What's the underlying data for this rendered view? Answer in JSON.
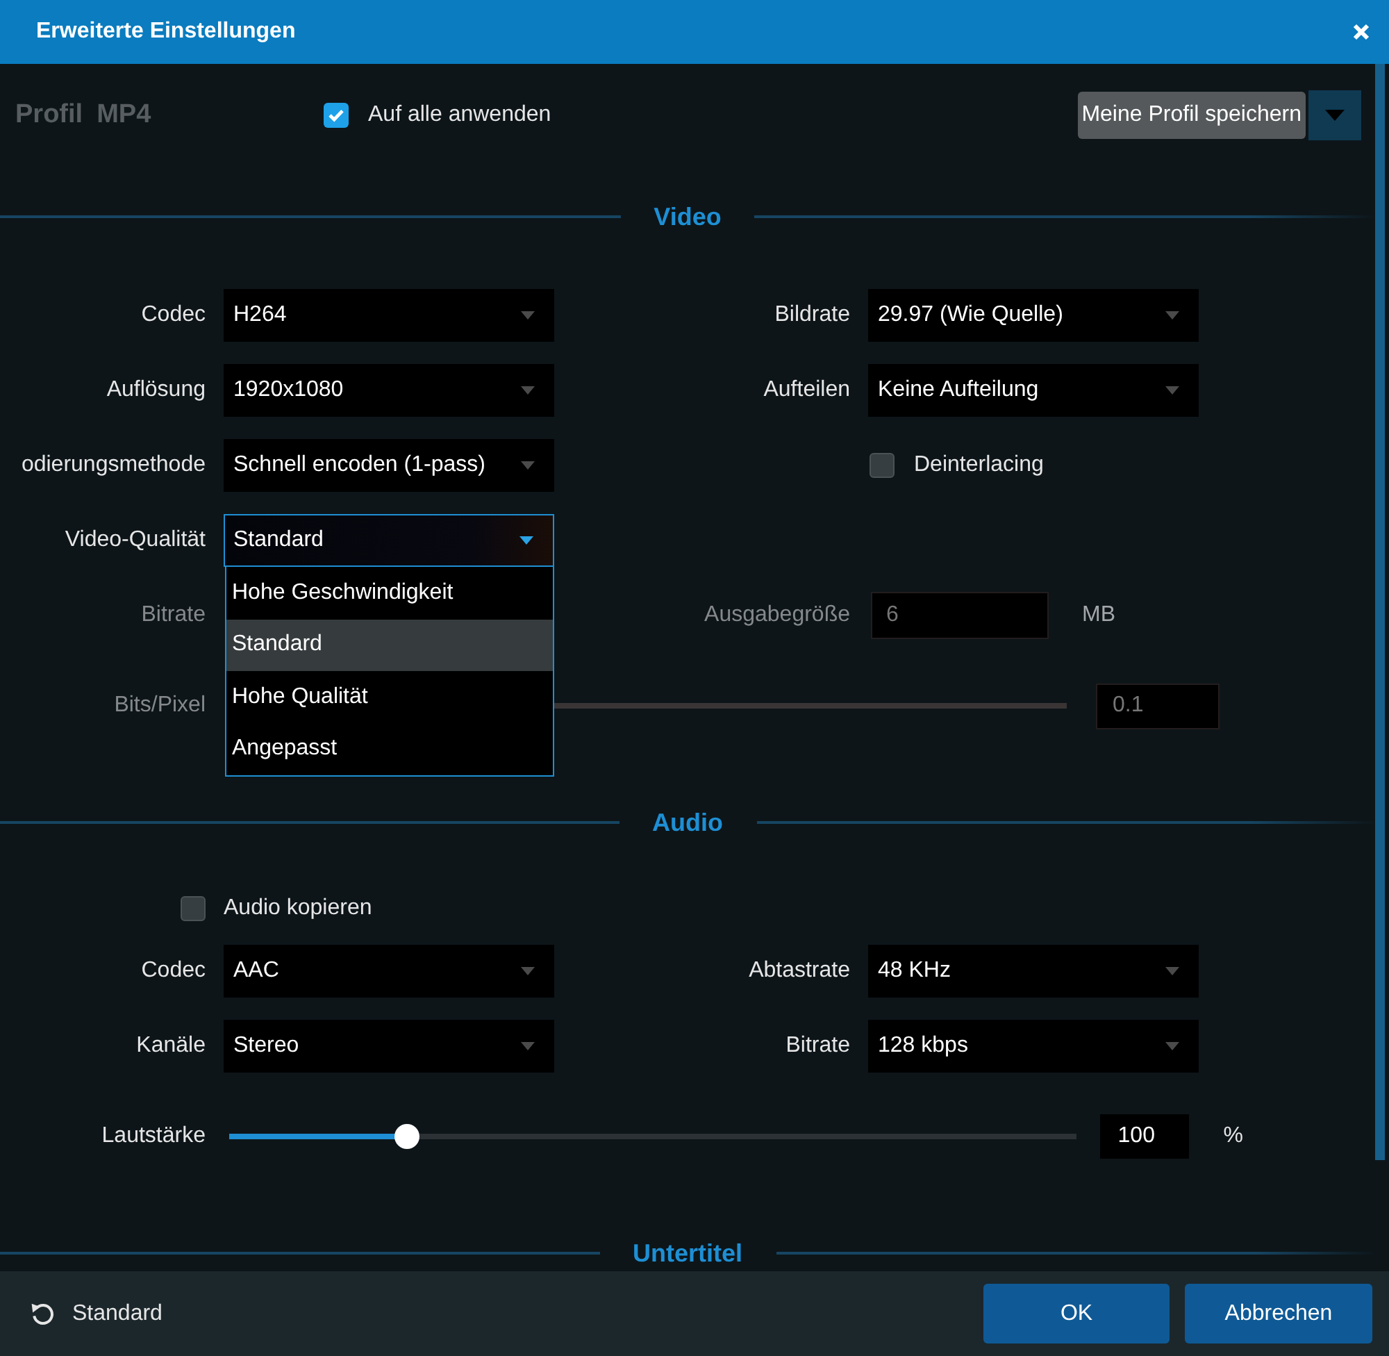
{
  "window": {
    "title": "Erweiterte Einstellungen"
  },
  "profile": {
    "label": "Profil",
    "name": "MP4",
    "apply_all": {
      "label": "Auf alle anwenden",
      "checked": true
    },
    "save_button": "Meine Profil speichern"
  },
  "sections": [
    {
      "title": "Video",
      "rows": [
        {
          "left": {
            "kind": "select",
            "label": "Codec",
            "value": "H264",
            "expanded": false,
            "disabled": false
          },
          "right": {
            "kind": "select",
            "label": "Bildrate",
            "value": "29.97 (Wie Quelle)",
            "expanded": false,
            "disabled": false
          }
        },
        {
          "left": {
            "kind": "select",
            "label": "Auflösung",
            "value": "1920x1080",
            "expanded": false,
            "disabled": false
          },
          "right": {
            "kind": "select",
            "label": "Aufteilen",
            "value": "Keine Aufteilung",
            "expanded": false,
            "disabled": false
          }
        },
        {
          "left": {
            "kind": "select",
            "label": "odierungsmethode",
            "value": "Schnell encoden (1-pass)",
            "expanded": false,
            "disabled": false
          },
          "right": {
            "kind": "checkbox",
            "label": "Deinterlacing",
            "checked": false,
            "disabled": false
          }
        },
        {
          "left": {
            "kind": "select",
            "label": "Video-Qualität",
            "value": "Standard",
            "expanded": true,
            "disabled": false,
            "options": [
              {
                "label": "Hohe Geschwindigkeit",
                "selected": false
              },
              {
                "label": "Standard",
                "selected": true
              },
              {
                "label": "Hohe Qualität",
                "selected": false
              },
              {
                "label": "Angepasst",
                "selected": false
              }
            ]
          }
        },
        {
          "left": {
            "kind": "label",
            "label": "Bitrate",
            "disabled": true
          },
          "right": {
            "kind": "number",
            "label": "Ausgabegröße",
            "value": "6",
            "unit": "MB",
            "disabled": true
          }
        },
        {
          "left": {
            "kind": "slider",
            "label": "Bits/Pixel",
            "value": "0.1",
            "disabled": true
          }
        }
      ]
    },
    {
      "title": "Audio",
      "rows": [
        {
          "left": {
            "kind": "checkbox",
            "label": "Audio kopieren",
            "checked": false,
            "disabled": false
          }
        },
        {
          "left": {
            "kind": "select",
            "label": "Codec",
            "value": "AAC",
            "expanded": false,
            "disabled": false
          },
          "right": {
            "kind": "select",
            "label": "Abtastrate",
            "value": "48 KHz",
            "expanded": false,
            "disabled": false
          }
        },
        {
          "left": {
            "kind": "select",
            "label": "Kanäle",
            "value": "Stereo",
            "expanded": false,
            "disabled": false
          },
          "right": {
            "kind": "select",
            "label": "Bitrate",
            "value": "128 kbps",
            "expanded": false,
            "disabled": false
          }
        },
        {
          "left": {
            "kind": "slider",
            "label": "Lautstärke",
            "level": 0.21,
            "value": "100",
            "unit": "%",
            "disabled": false
          }
        }
      ]
    },
    {
      "title": "Untertitel"
    }
  ],
  "footer": {
    "reset_button": "Standard",
    "buttons": [
      "OK",
      "Abbrechen"
    ]
  }
}
